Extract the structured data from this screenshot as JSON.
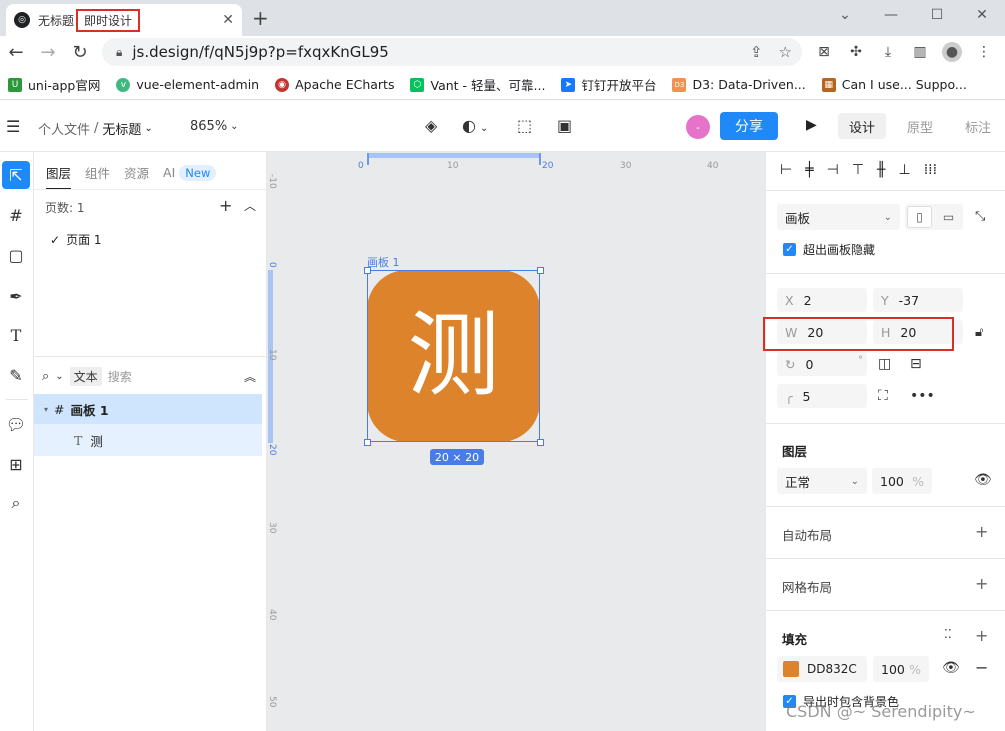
{
  "browser": {
    "tab": {
      "title": "无标题",
      "title_highlight": "即时设计",
      "close": "✕"
    },
    "new_tab": "+",
    "window_controls": [
      "⌄",
      "—",
      "☐",
      "✕"
    ],
    "url": "js.design/f/qN5j9p?p=fxqxKnGL95",
    "bookmarks": [
      {
        "label": "uni-app官网",
        "icon_color": "#2b9939",
        "icon_text": "U"
      },
      {
        "label": "vue-element-admin",
        "icon_color": "#41b883",
        "icon_text": "v"
      },
      {
        "label": "Apache ECharts",
        "icon_color": "#c23531",
        "icon_text": "◉"
      },
      {
        "label": "Vant - 轻量、可靠...",
        "icon_color": "#07c160",
        "icon_text": "⬡"
      },
      {
        "label": "钉钉开放平台",
        "icon_color": "#1677ff",
        "icon_text": "➤"
      },
      {
        "label": "D3: Data-Driven...",
        "icon_color": "#f68e56",
        "icon_text": "D3"
      },
      {
        "label": "Can I use... Suppo...",
        "icon_color": "#b5651d",
        "icon_text": "▦"
      }
    ]
  },
  "toolbar": {
    "breadcrumb_parent": "个人文件",
    "breadcrumb_sep": "/",
    "breadcrumb_current": "无标题",
    "zoom": "865%",
    "avatar_text": "-",
    "share_label": "分享",
    "modes": [
      "设计",
      "原型",
      "标注"
    ],
    "active_mode": "设计"
  },
  "layers_panel": {
    "tabs": [
      "图层",
      "组件",
      "资源",
      "AI"
    ],
    "new_badge": "New",
    "pages_count": "页数: 1",
    "page_item": "页面 1",
    "search_chip": "文本",
    "search_placeholder": "搜索",
    "layers": [
      {
        "name": "画板 1",
        "type": "frame"
      },
      {
        "name": "测",
        "type": "text"
      }
    ]
  },
  "canvas": {
    "hruler_ticks": [
      "0",
      "10",
      "20",
      "30",
      "40"
    ],
    "vruler_ticks": [
      "-10",
      "0",
      "10",
      "20",
      "30",
      "40",
      "50"
    ],
    "board_label": "画板 1",
    "board_text": "测",
    "board_color": "#DD832C",
    "dimensions": "20 × 20"
  },
  "properties": {
    "frame_type": "画板",
    "clip_content": "超出画板隐藏",
    "x": {
      "label": "X",
      "value": "2"
    },
    "y": {
      "label": "Y",
      "value": "-37"
    },
    "w": {
      "label": "W",
      "value": "20"
    },
    "h": {
      "label": "H",
      "value": "20"
    },
    "rotation": "0",
    "rotation_unit": "°",
    "radius": "5",
    "layer_section": "图层",
    "blend_mode": "正常",
    "opacity": "100",
    "pct": "%",
    "auto_layout": "自动布局",
    "grid_layout": "网格布局",
    "fill_section": "填充",
    "fill_hex": "DD832C",
    "fill_opacity": "100",
    "export_bg": "导出时包含背景色"
  },
  "watermark": "CSDN @~ Serendipity~"
}
